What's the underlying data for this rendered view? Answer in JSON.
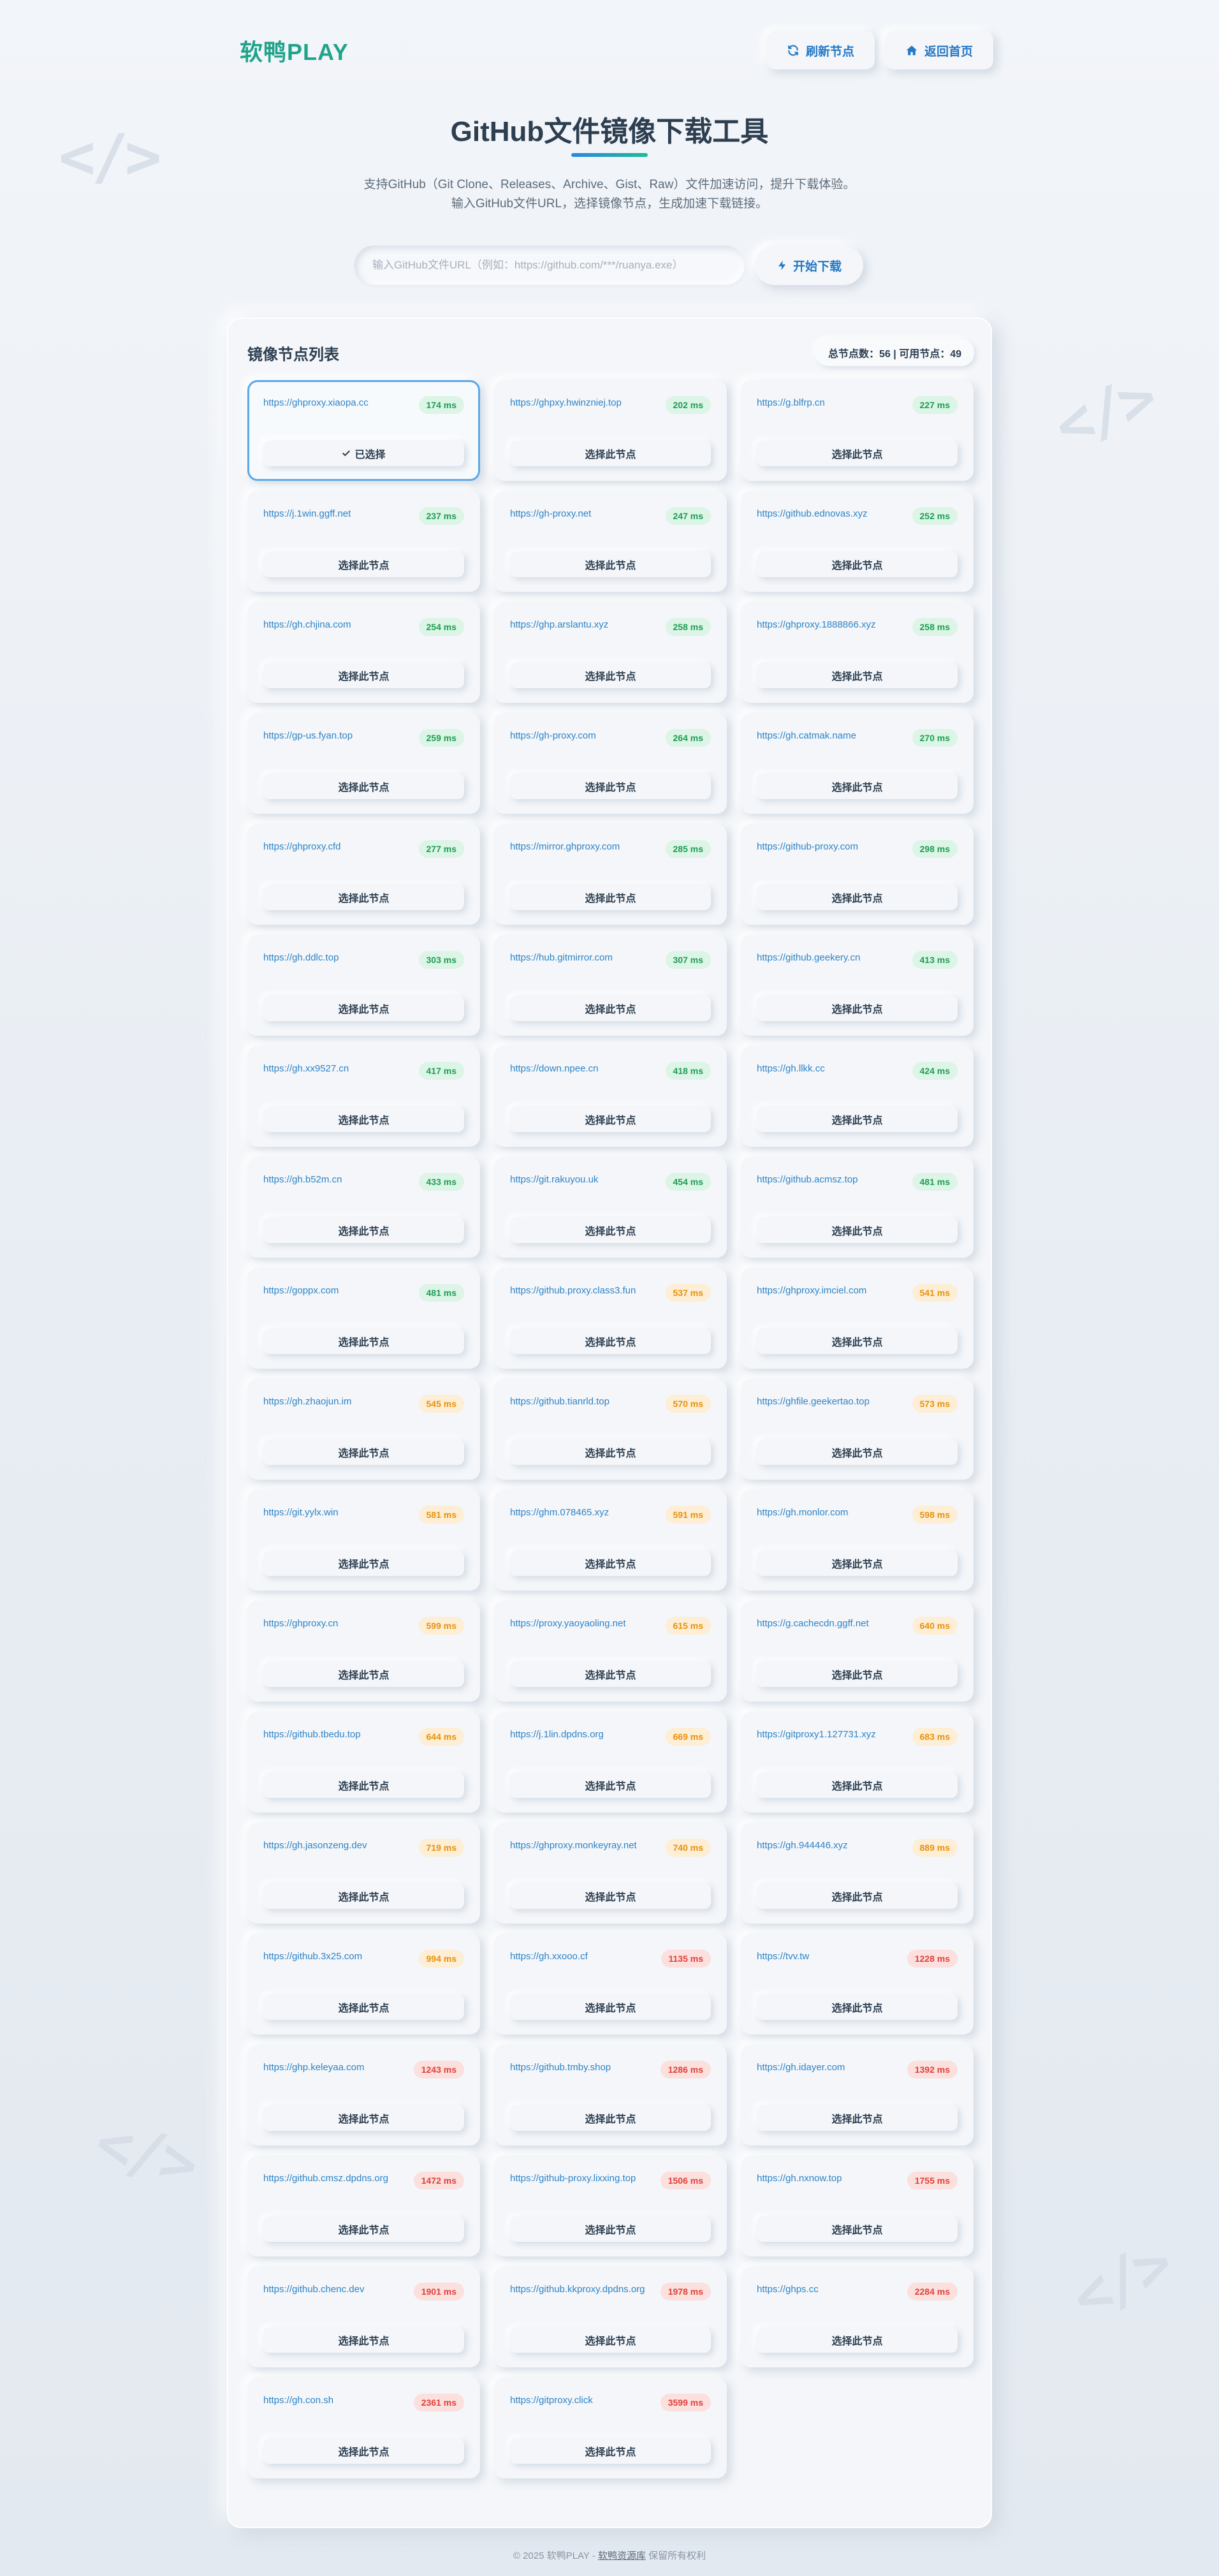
{
  "brand": "软鸭PLAY",
  "header": {
    "refresh_label": "刷新节点",
    "home_label": "返回首页"
  },
  "title": "GitHub文件镜像下载工具",
  "subtitle_line1": "支持GitHub（Git Clone、Releases、Archive、Gist、Raw）文件加速访问，提升下载体验。",
  "subtitle_line2": "输入GitHub文件URL，选择镜像节点，生成加速下载链接。",
  "search": {
    "placeholder": "输入GitHub文件URL（例如：https://github.com/***/ruanya.exe）",
    "value": ""
  },
  "download_label": "开始下载",
  "panel": {
    "title": "镜像节点列表",
    "stats": "总节点数：56 | 可用节点：49"
  },
  "colors": {
    "good": "#1f9d55",
    "medium": "#e8910c",
    "slow": "#e0413a",
    "accent": "#2478c6",
    "brand": "#1fa38a"
  },
  "select_label": "选择此节点",
  "selected_label": "已选择",
  "nodes": [
    {
      "url": "https://ghproxy.xiaopa.cc",
      "latency": "174 ms",
      "level": "g",
      "selected": true
    },
    {
      "url": "https://ghpxy.hwinzniej.top",
      "latency": "202 ms",
      "level": "g"
    },
    {
      "url": "https://g.blfrp.cn",
      "latency": "227 ms",
      "level": "g"
    },
    {
      "url": "https://j.1win.ggff.net",
      "latency": "237 ms",
      "level": "g"
    },
    {
      "url": "https://gh-proxy.net",
      "latency": "247 ms",
      "level": "g"
    },
    {
      "url": "https://github.ednovas.xyz",
      "latency": "252 ms",
      "level": "g"
    },
    {
      "url": "https://gh.chjina.com",
      "latency": "254 ms",
      "level": "g"
    },
    {
      "url": "https://ghp.arslantu.xyz",
      "latency": "258 ms",
      "level": "g"
    },
    {
      "url": "https://ghproxy.1888866.xyz",
      "latency": "258 ms",
      "level": "g"
    },
    {
      "url": "https://gp-us.fyan.top",
      "latency": "259 ms",
      "level": "g"
    },
    {
      "url": "https://gh-proxy.com",
      "latency": "264 ms",
      "level": "g"
    },
    {
      "url": "https://gh.catmak.name",
      "latency": "270 ms",
      "level": "g"
    },
    {
      "url": "https://ghproxy.cfd",
      "latency": "277 ms",
      "level": "g"
    },
    {
      "url": "https://mirror.ghproxy.com",
      "latency": "285 ms",
      "level": "g"
    },
    {
      "url": "https://github-proxy.com",
      "latency": "298 ms",
      "level": "g"
    },
    {
      "url": "https://gh.ddlc.top",
      "latency": "303 ms",
      "level": "g"
    },
    {
      "url": "https://hub.gitmirror.com",
      "latency": "307 ms",
      "level": "g"
    },
    {
      "url": "https://github.geekery.cn",
      "latency": "413 ms",
      "level": "g"
    },
    {
      "url": "https://gh.xx9527.cn",
      "latency": "417 ms",
      "level": "g"
    },
    {
      "url": "https://down.npee.cn",
      "latency": "418 ms",
      "level": "g"
    },
    {
      "url": "https://gh.llkk.cc",
      "latency": "424 ms",
      "level": "g"
    },
    {
      "url": "https://gh.b52m.cn",
      "latency": "433 ms",
      "level": "g"
    },
    {
      "url": "https://git.rakuyou.uk",
      "latency": "454 ms",
      "level": "g"
    },
    {
      "url": "https://github.acmsz.top",
      "latency": "481 ms",
      "level": "g"
    },
    {
      "url": "https://goppx.com",
      "latency": "481 ms",
      "level": "g"
    },
    {
      "url": "https://github.proxy.class3.fun",
      "latency": "537 ms",
      "level": "o"
    },
    {
      "url": "https://ghproxy.imciel.com",
      "latency": "541 ms",
      "level": "o"
    },
    {
      "url": "https://gh.zhaojun.im",
      "latency": "545 ms",
      "level": "o"
    },
    {
      "url": "https://github.tianrld.top",
      "latency": "570 ms",
      "level": "o"
    },
    {
      "url": "https://ghfile.geekertao.top",
      "latency": "573 ms",
      "level": "o"
    },
    {
      "url": "https://git.yylx.win",
      "latency": "581 ms",
      "level": "o"
    },
    {
      "url": "https://ghm.078465.xyz",
      "latency": "591 ms",
      "level": "o"
    },
    {
      "url": "https://gh.monlor.com",
      "latency": "598 ms",
      "level": "o"
    },
    {
      "url": "https://ghproxy.cn",
      "latency": "599 ms",
      "level": "o"
    },
    {
      "url": "https://proxy.yaoyaoling.net",
      "latency": "615 ms",
      "level": "o"
    },
    {
      "url": "https://g.cachecdn.ggff.net",
      "latency": "640 ms",
      "level": "o"
    },
    {
      "url": "https://github.tbedu.top",
      "latency": "644 ms",
      "level": "o"
    },
    {
      "url": "https://j.1lin.dpdns.org",
      "latency": "669 ms",
      "level": "o"
    },
    {
      "url": "https://gitproxy1.127731.xyz",
      "latency": "683 ms",
      "level": "o"
    },
    {
      "url": "https://gh.jasonzeng.dev",
      "latency": "719 ms",
      "level": "o"
    },
    {
      "url": "https://ghproxy.monkeyray.net",
      "latency": "740 ms",
      "level": "o"
    },
    {
      "url": "https://gh.944446.xyz",
      "latency": "889 ms",
      "level": "o"
    },
    {
      "url": "https://github.3x25.com",
      "latency": "994 ms",
      "level": "o"
    },
    {
      "url": "https://gh.xxooo.cf",
      "latency": "1135 ms",
      "level": "r"
    },
    {
      "url": "https://tvv.tw",
      "latency": "1228 ms",
      "level": "r"
    },
    {
      "url": "https://ghp.keleyaa.com",
      "latency": "1243 ms",
      "level": "r"
    },
    {
      "url": "https://github.tmby.shop",
      "latency": "1286 ms",
      "level": "r"
    },
    {
      "url": "https://gh.idayer.com",
      "latency": "1392 ms",
      "level": "r"
    },
    {
      "url": "https://github.cmsz.dpdns.org",
      "latency": "1472 ms",
      "level": "r"
    },
    {
      "url": "https://github-proxy.lixxing.top",
      "latency": "1506 ms",
      "level": "r"
    },
    {
      "url": "https://gh.nxnow.top",
      "latency": "1755 ms",
      "level": "r"
    },
    {
      "url": "https://github.chenc.dev",
      "latency": "1901 ms",
      "level": "r"
    },
    {
      "url": "https://github.kkproxy.dpdns.org",
      "latency": "1978 ms",
      "level": "r"
    },
    {
      "url": "https://ghps.cc",
      "latency": "2284 ms",
      "level": "r"
    },
    {
      "url": "https://gh.con.sh",
      "latency": "2361 ms",
      "level": "r"
    },
    {
      "url": "https://gitproxy.click",
      "latency": "3599 ms",
      "level": "r"
    }
  ],
  "footer": {
    "prefix": "© 2025 软鸭PLAY - ",
    "link": "软鸭资源库",
    "suffix": " 保留所有权利"
  }
}
